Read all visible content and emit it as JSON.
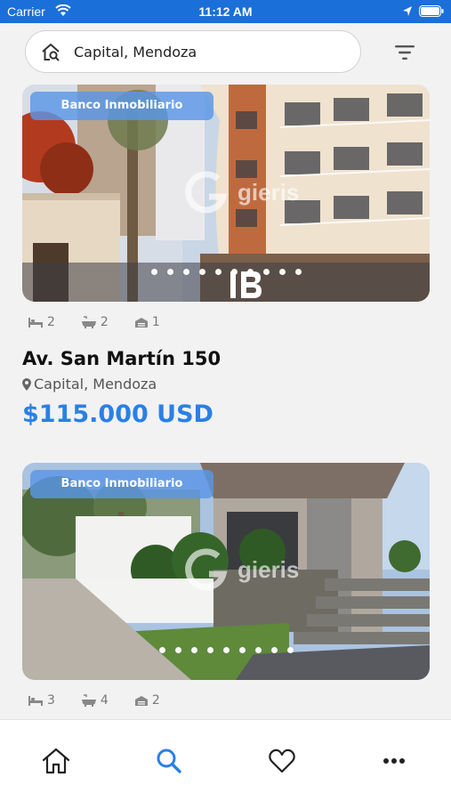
{
  "status_bar": {
    "carrier": "Carrier",
    "time": "11:12 AM"
  },
  "search": {
    "value": "Capital, Mendoza"
  },
  "colors": {
    "accent": "#2a80e6",
    "status_bar": "#1a6fd8",
    "tag": "#5a96e6"
  },
  "properties": [
    {
      "tag": "Banco Inmobiliario",
      "watermark": "gieris",
      "photo_count": 10,
      "beds": "2",
      "baths": "2",
      "garages": "1",
      "address": "Av. San Martín 150",
      "location": "Capital, Mendoza",
      "price": "$115.000 USD"
    },
    {
      "tag": "Banco Inmobiliario",
      "watermark": "gieris",
      "photo_count": 9,
      "beds": "3",
      "baths": "4",
      "garages": "2"
    }
  ],
  "tabs": [
    {
      "icon": "home-icon",
      "active": false
    },
    {
      "icon": "search-icon",
      "active": true
    },
    {
      "icon": "heart-icon",
      "active": false
    },
    {
      "icon": "more-icon",
      "active": false
    }
  ]
}
